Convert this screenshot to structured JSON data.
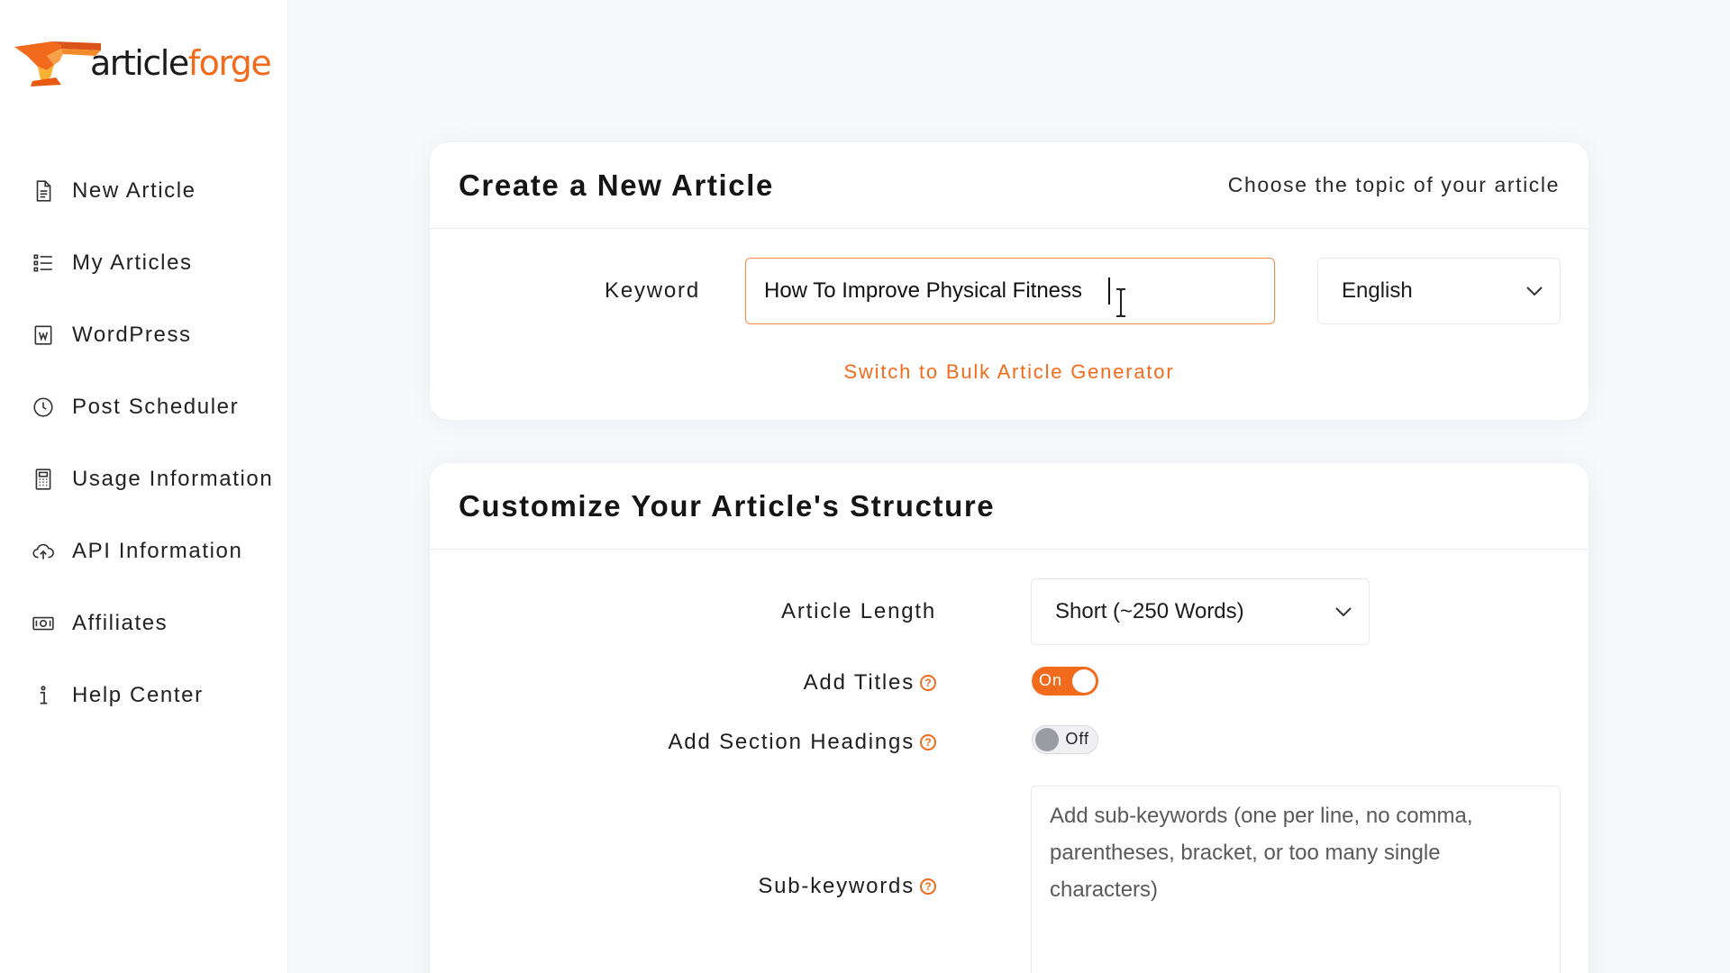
{
  "brand": {
    "logo_text_dark": "article",
    "logo_text_accent": "forge",
    "accent_color": "#f26b1d"
  },
  "sidebar": {
    "items": [
      {
        "label": "New Article",
        "icon": "document-icon"
      },
      {
        "label": "My Articles",
        "icon": "list-icon"
      },
      {
        "label": "WordPress",
        "icon": "wordpress-icon"
      },
      {
        "label": "Post Scheduler",
        "icon": "clock-icon"
      },
      {
        "label": "Usage Information",
        "icon": "calculator-icon"
      },
      {
        "label": "API Information",
        "icon": "cloud-upload-icon"
      },
      {
        "label": "Affiliates",
        "icon": "money-icon"
      },
      {
        "label": "Help Center",
        "icon": "info-icon"
      }
    ]
  },
  "create": {
    "title": "Create a New Article",
    "subtitle": "Choose the topic of your article",
    "keyword_label": "Keyword",
    "keyword_value": "How To Improve Physical Fitness",
    "language": "English",
    "bulk_link": "Switch to Bulk Article Generator"
  },
  "structure": {
    "title": "Customize Your Article's Structure",
    "length_label": "Article Length",
    "length_value": "Short (~250 Words)",
    "titles_label": "Add Titles",
    "titles_state": "On",
    "headings_label": "Add Section Headings",
    "headings_state": "Off",
    "subkeywords_label": "Sub-keywords",
    "subkeywords_placeholder": "Add sub-keywords (one per line, no comma, parentheses, bracket, or too many single characters)",
    "help_glyph": "?"
  }
}
